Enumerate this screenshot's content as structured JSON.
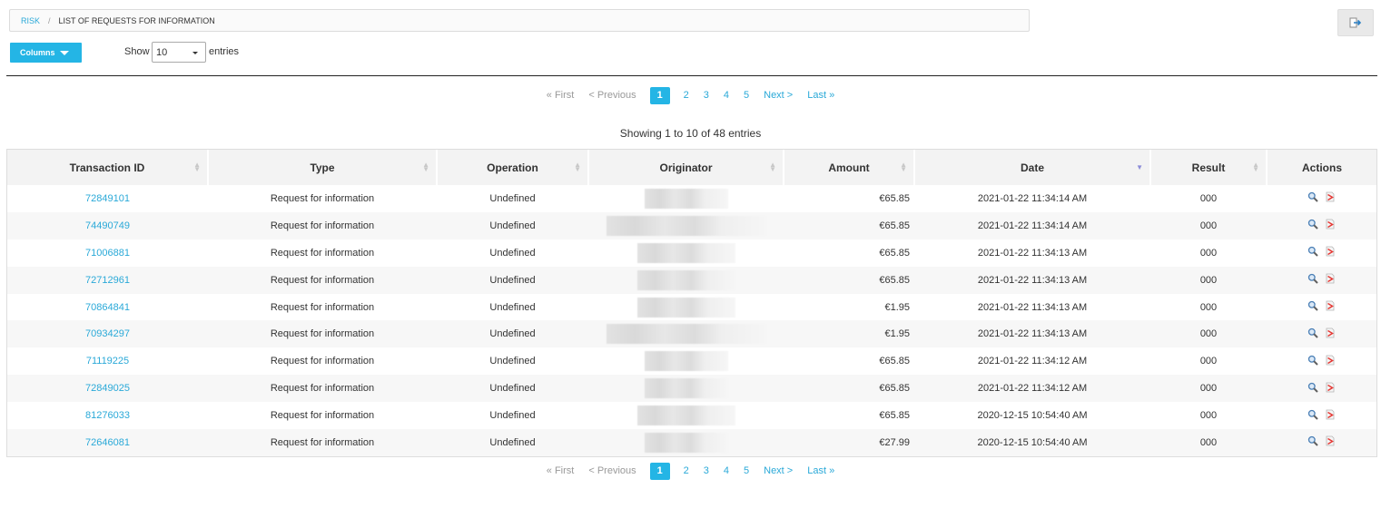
{
  "breadcrumb": {
    "root": "RISK",
    "separator": "/",
    "current": "LIST OF REQUESTS FOR INFORMATION"
  },
  "toolbar": {
    "columns_label": "Columns",
    "show_label": "Show",
    "entries_value": "10",
    "entries_label": "entries",
    "export_icon": "export-icon"
  },
  "pagination": {
    "first": "« First",
    "previous": "< Previous",
    "pages": [
      "1",
      "2",
      "3",
      "4",
      "5"
    ],
    "active": "1",
    "next": "Next >",
    "last": "Last »"
  },
  "info": "Showing 1 to 10 of 48 entries",
  "table": {
    "headers": [
      "Transaction ID",
      "Type",
      "Operation",
      "Originator",
      "Amount",
      "Date",
      "Result",
      "Actions"
    ],
    "rows": [
      {
        "id": "72849101",
        "type": "Request for information",
        "operation": "Undefined",
        "amount": "€65.85",
        "date": "2021-01-22 11:34:14 AM",
        "result": "000"
      },
      {
        "id": "74490749",
        "type": "Request for information",
        "operation": "Undefined",
        "amount": "€65.85",
        "date": "2021-01-22 11:34:14 AM",
        "result": "000"
      },
      {
        "id": "71006881",
        "type": "Request for information",
        "operation": "Undefined",
        "amount": "€65.85",
        "date": "2021-01-22 11:34:13 AM",
        "result": "000"
      },
      {
        "id": "72712961",
        "type": "Request for information",
        "operation": "Undefined",
        "amount": "€65.85",
        "date": "2021-01-22 11:34:13 AM",
        "result": "000"
      },
      {
        "id": "70864841",
        "type": "Request for information",
        "operation": "Undefined",
        "amount": "€1.95",
        "date": "2021-01-22 11:34:13 AM",
        "result": "000"
      },
      {
        "id": "70934297",
        "type": "Request for information",
        "operation": "Undefined",
        "amount": "€1.95",
        "date": "2021-01-22 11:34:13 AM",
        "result": "000"
      },
      {
        "id": "71119225",
        "type": "Request for information",
        "operation": "Undefined",
        "amount": "€65.85",
        "date": "2021-01-22 11:34:12 AM",
        "result": "000"
      },
      {
        "id": "72849025",
        "type": "Request for information",
        "operation": "Undefined",
        "amount": "€65.85",
        "date": "2021-01-22 11:34:12 AM",
        "result": "000"
      },
      {
        "id": "81276033",
        "type": "Request for information",
        "operation": "Undefined",
        "amount": "€65.85",
        "date": "2020-12-15 10:54:40 AM",
        "result": "000"
      },
      {
        "id": "72646081",
        "type": "Request for information",
        "operation": "Undefined",
        "amount": "€27.99",
        "date": "2020-12-15 10:54:40 AM",
        "result": "000"
      }
    ],
    "action_icons": [
      "view-icon",
      "pdf-icon"
    ]
  },
  "colors": {
    "accent": "#24b5e5",
    "link": "#2aa9d8",
    "header_bg": "#f3f3f3",
    "row_alt": "#f7f7f7"
  }
}
